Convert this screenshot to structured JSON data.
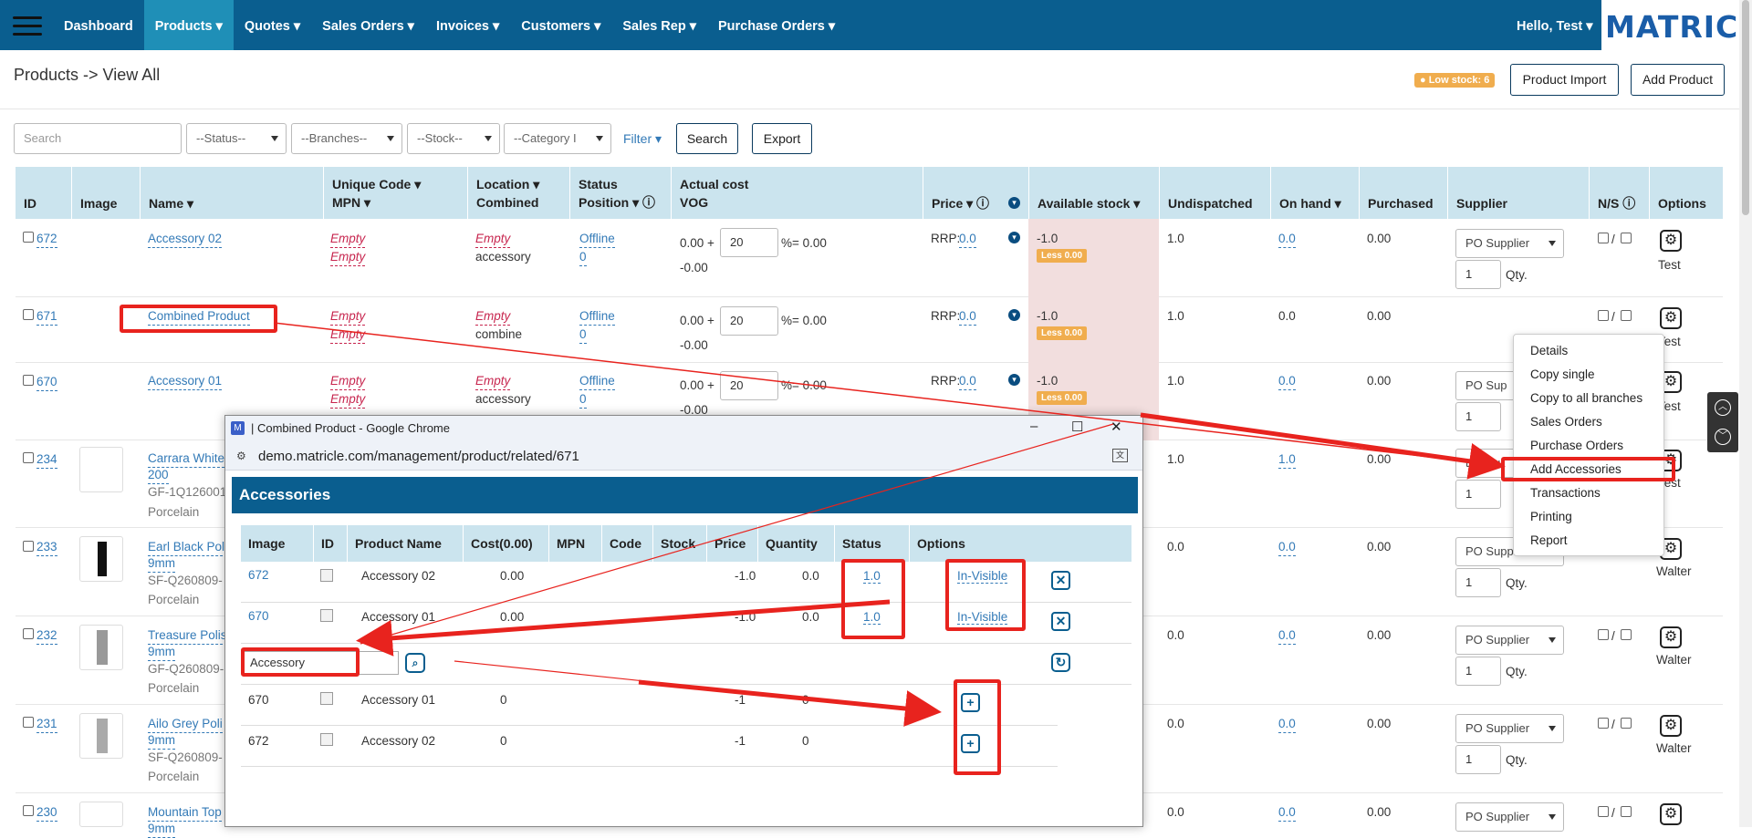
{
  "nav": {
    "items": [
      "Dashboard",
      "Products ▾",
      "Quotes ▾",
      "Sales Orders ▾",
      "Invoices ▾",
      "Customers ▾",
      "Sales Rep ▾",
      "Purchase Orders ▾"
    ],
    "active": "Products ▾",
    "greeting": "Hello, Test ▾",
    "logo": "MATRICLE",
    "color": "#0a5e8f"
  },
  "page": {
    "title": "Products -> View All",
    "low_stock": "Low stock: 6",
    "import_label": "Product Import",
    "add_label": "Add Product"
  },
  "filters": {
    "search_placeholder": "Search",
    "status": "--Status--",
    "branches": "--Branches--",
    "stock": "--Stock--",
    "category": "--Category I",
    "filter_label": "Filter ▾",
    "search_button": "Search",
    "export_button": "Export"
  },
  "table": {
    "headers": {
      "id": "ID",
      "image": "Image",
      "name": "Name ▾",
      "unique": "Unique Code ▾",
      "mpn": "MPN ▾",
      "location": "Location ▾",
      "combined": "Combined",
      "status": "Status",
      "position": "Position ▾ ⓘ",
      "actual": "Actual cost",
      "vog": "VOG",
      "price": "Price ▾ ⓘ",
      "avail": "Available stock ▾",
      "undisp": "Undispatched",
      "onhand": "On hand ▾",
      "purchased": "Purchased",
      "supplier": "Supplier",
      "ns": "N/S ⓘ",
      "options": "Options"
    },
    "rows": [
      {
        "id": "672",
        "name": "Accessory 02",
        "code": "Empty",
        "mpn": "Empty",
        "loc": "Empty",
        "comb": "accessory",
        "status": "Offline",
        "pos": "0",
        "cost": "0.00 +",
        "vog": "20",
        "pct": "%= 0.00",
        "neg": "-0.00",
        "rrp": "RRP:",
        "price": "0.0",
        "avail": "-1.0",
        "less": "Less 0.00",
        "undisp": "1.0",
        "onhand": "0.0",
        "purch": "0.00",
        "supplier": "PO Supplier",
        "qty": "1",
        "qty_label": "Qty.",
        "user": "Test"
      },
      {
        "id": "671",
        "name": "Combined Product",
        "code": "Empty",
        "mpn": "Empty",
        "loc": "Empty",
        "comb": "combine",
        "status": "Offline",
        "pos": "0",
        "cost": "0.00 +",
        "vog": "20",
        "pct": "%= 0.00",
        "neg": "-0.00",
        "rrp": "RRP:",
        "price": "0.0",
        "avail": "-1.0",
        "less": "Less 0.00",
        "undisp": "1.0",
        "onhand": "0.0",
        "purch": "0.00",
        "user": "Test"
      },
      {
        "id": "670",
        "name": "Accessory 01",
        "code": "Empty",
        "mpn": "Empty",
        "loc": "Empty",
        "comb": "accessory",
        "status": "Offline",
        "pos": "0",
        "cost": "0.00 +",
        "vog": "20",
        "pct": "%= 0.00",
        "neg": "-0.00",
        "rrp": "RRP:",
        "price": "0.0",
        "avail": "-1.0",
        "less": "Less 0.00",
        "undisp": "1.0",
        "onhand": "0.0",
        "purch": "0.00",
        "supplier": "PO Sup",
        "qty": "1",
        "user": "Test"
      },
      {
        "id": "234",
        "name": "Carrara White",
        "name2": "200",
        "sku": "GF-1Q126001",
        "mat": "Porcelain",
        "undisp": "1.0",
        "onhand": "1.0",
        "purch": "0.00",
        "supplier": "test su",
        "qty": "1",
        "qty_label": "Qty.",
        "user": "Test"
      },
      {
        "id": "233",
        "name": "Earl Black Poli",
        "name2": "9mm",
        "sku": "SF-Q260809-",
        "mat": "Porcelain",
        "undisp": "0.0",
        "onhand": "0.0",
        "purch": "0.00",
        "supplier": "PO Supp",
        "qty": "1",
        "qty_label": "Qty.",
        "user": "Walter"
      },
      {
        "id": "232",
        "name": "Treasure Polis",
        "name2": "9mm",
        "sku": "GF-Q260809-",
        "mat": "Porcelain",
        "undisp": "0.0",
        "onhand": "0.0",
        "purch": "0.00",
        "supplier": "PO Supplier",
        "qty": "1",
        "qty_label": "Qty.",
        "user": "Walter"
      },
      {
        "id": "231",
        "name": "Ailo Grey Poli",
        "name2": "9mm",
        "sku": "SF-Q260809-",
        "mat": "Porcelain",
        "undisp": "0.0",
        "onhand": "0.0",
        "purch": "0.00",
        "supplier": "PO Supplier",
        "qty": "1",
        "qty_label": "Qty.",
        "user": "Walter"
      },
      {
        "id": "230",
        "name": "Mountain Top",
        "name2": "9mm",
        "undisp": "0.0",
        "onhand": "0.0",
        "purch": "0.00",
        "supplier": "PO Supplier"
      }
    ]
  },
  "context_menu": [
    "Details",
    "Copy single",
    "Copy to all branches",
    "Sales Orders",
    "Purchase Orders",
    "Add Accessories",
    "Transactions",
    "Printing",
    "Report"
  ],
  "popup": {
    "window_title": "| Combined Product - Google Chrome",
    "icon": "M",
    "url": "demo.matricle.com/management/product/related/671",
    "heading": "Accessories",
    "headers": [
      "Image",
      "ID",
      "Product Name",
      "Cost(0.00)",
      "MPN",
      "Code",
      "Stock",
      "Price",
      "Quantity",
      "Status",
      "Options"
    ],
    "related": [
      {
        "id": "672",
        "name": "Accessory 02",
        "cost": "0.00",
        "stock": "-1.0",
        "price": "0.0",
        "qty": "1.0",
        "status": "In-Visible"
      },
      {
        "id": "670",
        "name": "Accessory 01",
        "cost": "0.00",
        "stock": "-1.0",
        "price": "0.0",
        "qty": "1.0",
        "status": "In-Visible"
      }
    ],
    "search_value": "Accessory",
    "results": [
      {
        "id": "670",
        "name": "Accessory 01",
        "cost": "0",
        "stock": "-1",
        "price": "0"
      },
      {
        "id": "672",
        "name": "Accessory 02",
        "cost": "0",
        "stock": "-1",
        "price": "0"
      }
    ]
  },
  "annotation_color": "#e8231e"
}
